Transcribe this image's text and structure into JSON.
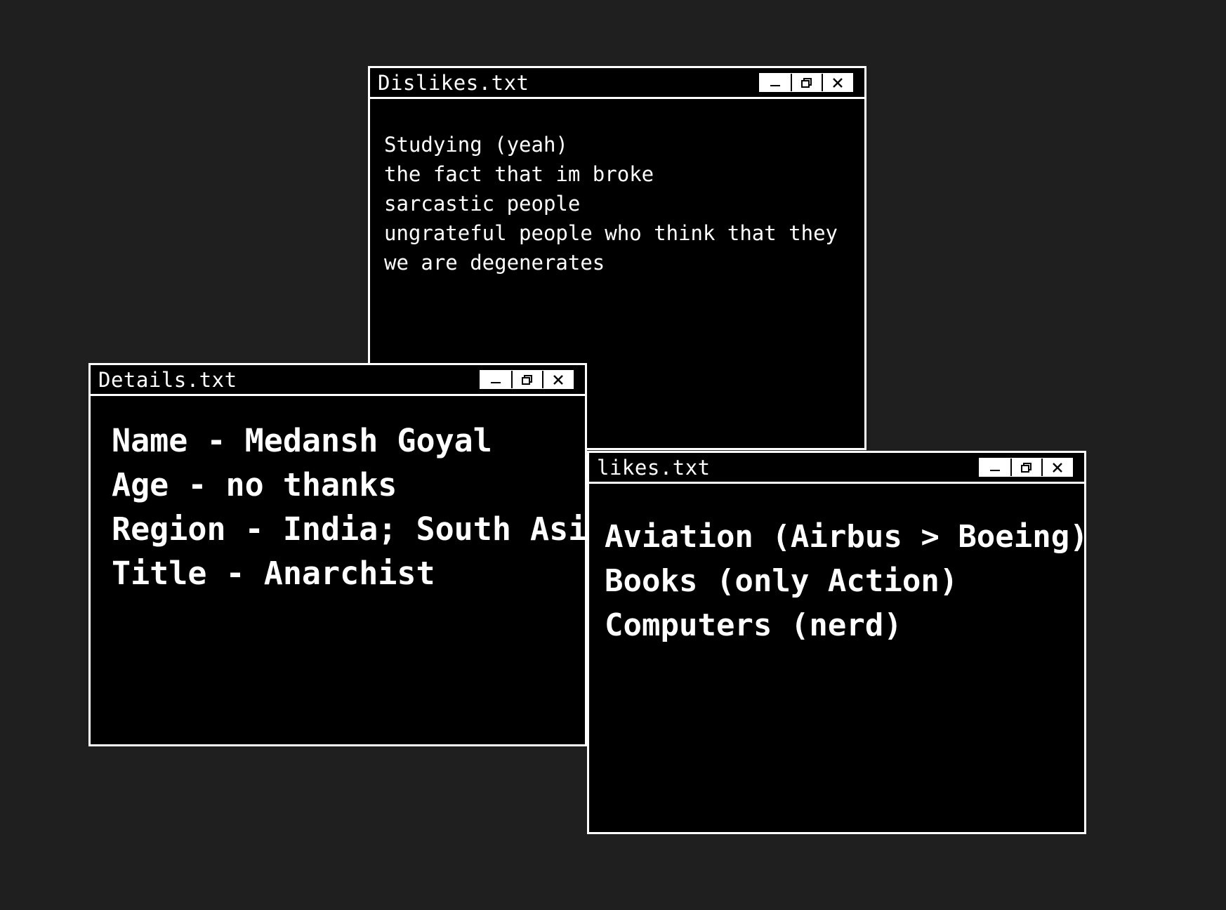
{
  "windows": {
    "dislikes": {
      "title": "Dislikes.txt",
      "lines": [
        "Studying (yeah)",
        "the fact that im broke",
        "sarcastic people",
        "ungrateful people who think that they",
        "we are degenerates"
      ]
    },
    "details": {
      "title": "Details.txt",
      "lines": [
        "Name - Medansh Goyal",
        "Age - no thanks",
        "Region - India; South Asia",
        "Title - Anarchist"
      ]
    },
    "likes": {
      "title": "likes.txt",
      "lines": [
        "Aviation (Airbus > Boeing)",
        "Books (only  Action)",
        "Computers (nerd)"
      ]
    }
  },
  "controls": {
    "minimize_icon": "minimize-icon",
    "restore_icon": "restore-icon",
    "close_icon": "close-icon"
  },
  "colors": {
    "desktop": "#1f1f1f",
    "window_bg": "#000000",
    "border": "#ffffff",
    "text": "#ffffff"
  }
}
